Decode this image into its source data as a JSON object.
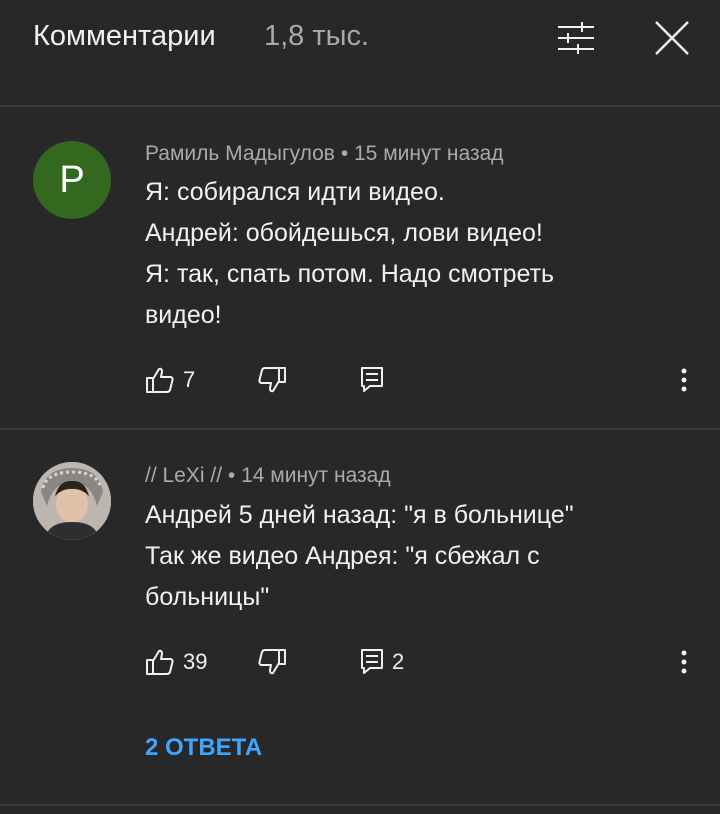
{
  "header": {
    "title": "Комментарии",
    "count": "1,8 тыс.",
    "filter_icon": "sort-sliders-icon",
    "close_icon": "close-icon"
  },
  "comments": [
    {
      "avatar_letter": "P",
      "avatar_color": "#33691e",
      "author": "Рамиль Мадыгулов",
      "time": "15 минут назад",
      "lines": [
        "Я: собирался идти видео.",
        "Андрей: обойдешься, лови видео!",
        "Я: так, спать потом. Надо смотреть",
        "видео!"
      ],
      "likes": "7",
      "reply_count": ""
    },
    {
      "avatar_letter": "",
      "author": "// LeXi //",
      "time": "14 минут назад",
      "lines": [
        "Андрей 5 дней назад: \"я в больнице\"",
        "Так же видео Андрея: \"я сбежал с",
        "больницы\""
      ],
      "likes": "39",
      "reply_count": "2"
    }
  ],
  "replies_link": "2 ОТВЕТА",
  "colors": {
    "background": "#282828",
    "accent_link": "#3ea6ff",
    "secondary_text": "#aaaaaa"
  }
}
